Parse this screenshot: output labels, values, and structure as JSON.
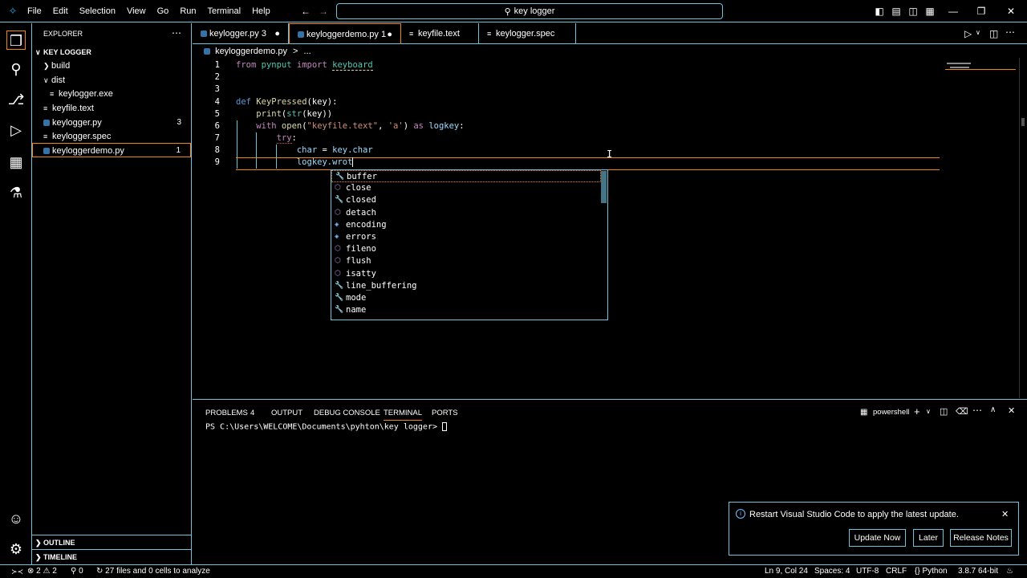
{
  "menu": [
    "File",
    "Edit",
    "Selection",
    "View",
    "Go",
    "Run",
    "Terminal",
    "Help"
  ],
  "search": {
    "text": "key logger"
  },
  "sidebar": {
    "title": "EXPLORER",
    "root": "KEY LOGGER",
    "items": [
      {
        "label": "build",
        "type": "folder",
        "expanded": false
      },
      {
        "label": "dist",
        "type": "folder",
        "expanded": true
      },
      {
        "label": "keylogger.exe",
        "type": "file"
      },
      {
        "label": "keyfile.text",
        "type": "file"
      },
      {
        "label": "keylogger.py",
        "type": "python",
        "count": "3"
      },
      {
        "label": "keylogger.spec",
        "type": "file"
      },
      {
        "label": "keyloggerdemo.py",
        "type": "python",
        "count": "1"
      }
    ],
    "outline": "OUTLINE",
    "timeline": "TIMELINE"
  },
  "tabs": [
    {
      "label": "keylogger.py 3",
      "modified": true
    },
    {
      "label": "keyloggerdemo.py 1",
      "modified": true,
      "active": true
    },
    {
      "label": "keyfile.text"
    },
    {
      "label": "keylogger.spec"
    }
  ],
  "breadcrumb": {
    "file": "keyloggerdemo.py",
    "sep": ">",
    "rest": "..."
  },
  "editor": {
    "line_numbers": [
      "1",
      "2",
      "3",
      "4",
      "5",
      "6",
      "7",
      "8",
      "9"
    ],
    "l1_from": "from",
    "l1_mod": "pynput",
    "l1_import": "import",
    "l1_name": "keyboard",
    "l4_def": "def",
    "l4_fn": "KeyPressed",
    "l4_rest": "(key):",
    "l5_print": "print",
    "l5_p1": "(",
    "l5_str": "str",
    "l5_rest": "(key))",
    "l6_with": "with",
    "l6_open": "open",
    "l6_p": "(",
    "l6_s1": "\"keyfile.text\"",
    "l6_c": ", ",
    "l6_s2": "'a'",
    "l6_p2": ")",
    "l6_as": " as ",
    "l6_var": "logkey",
    "l6_end": ":",
    "l7_try": "try",
    "l7_end": ":",
    "l8_var": "char",
    "l8_eq": " = ",
    "l8_key": "key",
    "l8_attr": ".char",
    "l9_var": "logkey",
    "l9_attr": ".wrot"
  },
  "suggest": {
    "items": [
      {
        "label": "buffer",
        "icon": "wrench"
      },
      {
        "label": "close",
        "icon": "method"
      },
      {
        "label": "closed",
        "icon": "wrench"
      },
      {
        "label": "detach",
        "icon": "method"
      },
      {
        "label": "encoding",
        "icon": "field"
      },
      {
        "label": "errors",
        "icon": "field"
      },
      {
        "label": "fileno",
        "icon": "method"
      },
      {
        "label": "flush",
        "icon": "method"
      },
      {
        "label": "isatty",
        "icon": "method"
      },
      {
        "label": "line_buffering",
        "icon": "wrench"
      },
      {
        "label": "mode",
        "icon": "wrench"
      },
      {
        "label": "name",
        "icon": "wrench"
      }
    ]
  },
  "panel": {
    "tabs": [
      "PROBLEMS",
      "4",
      "OUTPUT",
      "DEBUG CONSOLE",
      "TERMINAL",
      "PORTS"
    ],
    "shell": "powershell",
    "prompt": "PS C:\\Users\\WELCOME\\Documents\\pyhton\\key logger> "
  },
  "notification": {
    "message": "Restart Visual Studio Code to apply the latest update.",
    "buttons": [
      "Update Now",
      "Later",
      "Release Notes"
    ]
  },
  "status": {
    "errors": "2",
    "warnings": "2",
    "ports": "0",
    "analysis": "27 files and 0 cells to analyze",
    "position": "Ln 9, Col 24",
    "spaces": "Spaces: 4",
    "encoding": "UTF-8",
    "eol": "CRLF",
    "language": "Python",
    "interpreter": "3.8.7 64-bit"
  },
  "colors": {
    "border": "#6fc3df",
    "focus": "#f38518"
  }
}
